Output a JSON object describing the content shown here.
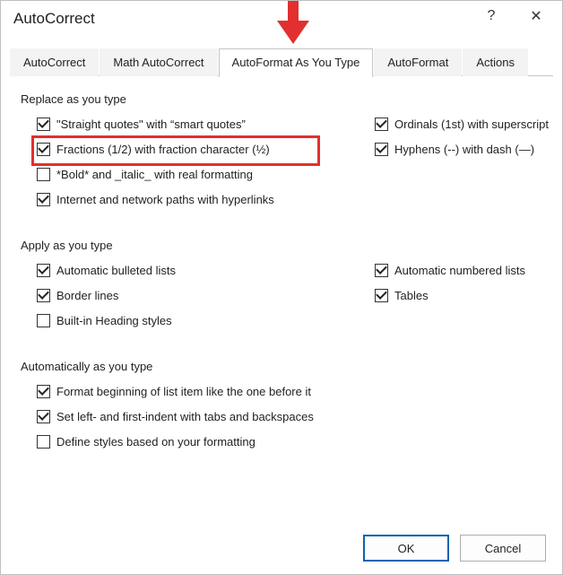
{
  "title": "AutoCorrect",
  "help_char": "?",
  "close_char": "✕",
  "tabs": {
    "t0": "AutoCorrect",
    "t1": "Math AutoCorrect",
    "t2": "AutoFormat As You Type",
    "t3": "AutoFormat",
    "t4": "Actions"
  },
  "section1": {
    "title": "Replace as you type",
    "left": {
      "o0": "\"Straight quotes\" with “smart quotes”",
      "o1": "Fractions (1/2) with fraction character (½)",
      "o2": "*Bold* and _italic_ with real formatting",
      "o3": "Internet and network paths with hyperlinks"
    },
    "right": {
      "o0": "Ordinals (1st) with superscript",
      "o1": "Hyphens (--) with dash (—)"
    }
  },
  "section2": {
    "title": "Apply as you type",
    "left": {
      "o0": "Automatic bulleted lists",
      "o1": "Border lines",
      "o2": "Built-in Heading styles"
    },
    "right": {
      "o0": "Automatic numbered lists",
      "o1": "Tables"
    }
  },
  "section3": {
    "title": "Automatically as you type",
    "o0": "Format beginning of list item like the one before it",
    "o1": "Set left- and first-indent with tabs and backspaces",
    "o2": "Define styles based on your formatting"
  },
  "buttons": {
    "ok": "OK",
    "cancel": "Cancel"
  },
  "checked": {
    "s1l0": true,
    "s1l1": true,
    "s1l2": false,
    "s1l3": true,
    "s1r0": true,
    "s1r1": true,
    "s2l0": true,
    "s2l1": true,
    "s2l2": false,
    "s2r0": true,
    "s2r1": true,
    "s3o0": true,
    "s3o1": true,
    "s3o2": false
  },
  "colors": {
    "highlight": "#e22f2f",
    "primary_border": "#0a64ad"
  }
}
